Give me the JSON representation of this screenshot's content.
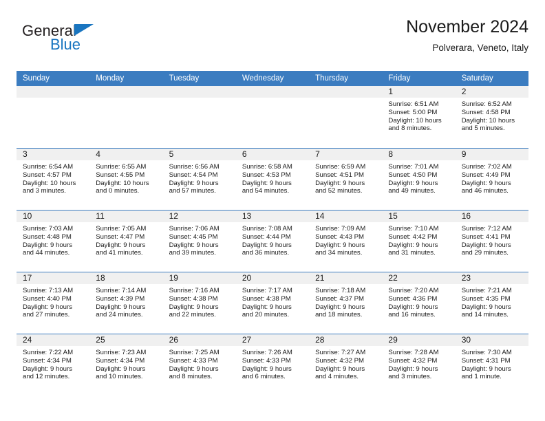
{
  "logo": {
    "word1": "General",
    "word2": "Blue",
    "triangle_color": "#1975c0",
    "icon": "triangle-icon"
  },
  "header": {
    "title": "November 2024",
    "subtitle": "Polverara, Veneto, Italy"
  },
  "theme": {
    "header_blue": "#3b7cc0",
    "daynum_gray": "#f0f0f0",
    "accent": "#1975c0"
  },
  "calendar": {
    "weekdays": [
      "Sunday",
      "Monday",
      "Tuesday",
      "Wednesday",
      "Thursday",
      "Friday",
      "Saturday"
    ],
    "weeks": [
      [
        {
          "day": "",
          "empty": true,
          "lines": []
        },
        {
          "day": "",
          "empty": true,
          "lines": []
        },
        {
          "day": "",
          "empty": true,
          "lines": []
        },
        {
          "day": "",
          "empty": true,
          "lines": []
        },
        {
          "day": "",
          "empty": true,
          "lines": []
        },
        {
          "day": "1",
          "empty": false,
          "lines": [
            "Sunrise: 6:51 AM",
            "Sunset: 5:00 PM",
            "Daylight: 10 hours",
            "and 8 minutes."
          ]
        },
        {
          "day": "2",
          "empty": false,
          "lines": [
            "Sunrise: 6:52 AM",
            "Sunset: 4:58 PM",
            "Daylight: 10 hours",
            "and 5 minutes."
          ]
        }
      ],
      [
        {
          "day": "3",
          "empty": false,
          "lines": [
            "Sunrise: 6:54 AM",
            "Sunset: 4:57 PM",
            "Daylight: 10 hours",
            "and 3 minutes."
          ]
        },
        {
          "day": "4",
          "empty": false,
          "lines": [
            "Sunrise: 6:55 AM",
            "Sunset: 4:55 PM",
            "Daylight: 10 hours",
            "and 0 minutes."
          ]
        },
        {
          "day": "5",
          "empty": false,
          "lines": [
            "Sunrise: 6:56 AM",
            "Sunset: 4:54 PM",
            "Daylight: 9 hours",
            "and 57 minutes."
          ]
        },
        {
          "day": "6",
          "empty": false,
          "lines": [
            "Sunrise: 6:58 AM",
            "Sunset: 4:53 PM",
            "Daylight: 9 hours",
            "and 54 minutes."
          ]
        },
        {
          "day": "7",
          "empty": false,
          "lines": [
            "Sunrise: 6:59 AM",
            "Sunset: 4:51 PM",
            "Daylight: 9 hours",
            "and 52 minutes."
          ]
        },
        {
          "day": "8",
          "empty": false,
          "lines": [
            "Sunrise: 7:01 AM",
            "Sunset: 4:50 PM",
            "Daylight: 9 hours",
            "and 49 minutes."
          ]
        },
        {
          "day": "9",
          "empty": false,
          "lines": [
            "Sunrise: 7:02 AM",
            "Sunset: 4:49 PM",
            "Daylight: 9 hours",
            "and 46 minutes."
          ]
        }
      ],
      [
        {
          "day": "10",
          "empty": false,
          "lines": [
            "Sunrise: 7:03 AM",
            "Sunset: 4:48 PM",
            "Daylight: 9 hours",
            "and 44 minutes."
          ]
        },
        {
          "day": "11",
          "empty": false,
          "lines": [
            "Sunrise: 7:05 AM",
            "Sunset: 4:47 PM",
            "Daylight: 9 hours",
            "and 41 minutes."
          ]
        },
        {
          "day": "12",
          "empty": false,
          "lines": [
            "Sunrise: 7:06 AM",
            "Sunset: 4:45 PM",
            "Daylight: 9 hours",
            "and 39 minutes."
          ]
        },
        {
          "day": "13",
          "empty": false,
          "lines": [
            "Sunrise: 7:08 AM",
            "Sunset: 4:44 PM",
            "Daylight: 9 hours",
            "and 36 minutes."
          ]
        },
        {
          "day": "14",
          "empty": false,
          "lines": [
            "Sunrise: 7:09 AM",
            "Sunset: 4:43 PM",
            "Daylight: 9 hours",
            "and 34 minutes."
          ]
        },
        {
          "day": "15",
          "empty": false,
          "lines": [
            "Sunrise: 7:10 AM",
            "Sunset: 4:42 PM",
            "Daylight: 9 hours",
            "and 31 minutes."
          ]
        },
        {
          "day": "16",
          "empty": false,
          "lines": [
            "Sunrise: 7:12 AM",
            "Sunset: 4:41 PM",
            "Daylight: 9 hours",
            "and 29 minutes."
          ]
        }
      ],
      [
        {
          "day": "17",
          "empty": false,
          "lines": [
            "Sunrise: 7:13 AM",
            "Sunset: 4:40 PM",
            "Daylight: 9 hours",
            "and 27 minutes."
          ]
        },
        {
          "day": "18",
          "empty": false,
          "lines": [
            "Sunrise: 7:14 AM",
            "Sunset: 4:39 PM",
            "Daylight: 9 hours",
            "and 24 minutes."
          ]
        },
        {
          "day": "19",
          "empty": false,
          "lines": [
            "Sunrise: 7:16 AM",
            "Sunset: 4:38 PM",
            "Daylight: 9 hours",
            "and 22 minutes."
          ]
        },
        {
          "day": "20",
          "empty": false,
          "lines": [
            "Sunrise: 7:17 AM",
            "Sunset: 4:38 PM",
            "Daylight: 9 hours",
            "and 20 minutes."
          ]
        },
        {
          "day": "21",
          "empty": false,
          "lines": [
            "Sunrise: 7:18 AM",
            "Sunset: 4:37 PM",
            "Daylight: 9 hours",
            "and 18 minutes."
          ]
        },
        {
          "day": "22",
          "empty": false,
          "lines": [
            "Sunrise: 7:20 AM",
            "Sunset: 4:36 PM",
            "Daylight: 9 hours",
            "and 16 minutes."
          ]
        },
        {
          "day": "23",
          "empty": false,
          "lines": [
            "Sunrise: 7:21 AM",
            "Sunset: 4:35 PM",
            "Daylight: 9 hours",
            "and 14 minutes."
          ]
        }
      ],
      [
        {
          "day": "24",
          "empty": false,
          "lines": [
            "Sunrise: 7:22 AM",
            "Sunset: 4:34 PM",
            "Daylight: 9 hours",
            "and 12 minutes."
          ]
        },
        {
          "day": "25",
          "empty": false,
          "lines": [
            "Sunrise: 7:23 AM",
            "Sunset: 4:34 PM",
            "Daylight: 9 hours",
            "and 10 minutes."
          ]
        },
        {
          "day": "26",
          "empty": false,
          "lines": [
            "Sunrise: 7:25 AM",
            "Sunset: 4:33 PM",
            "Daylight: 9 hours",
            "and 8 minutes."
          ]
        },
        {
          "day": "27",
          "empty": false,
          "lines": [
            "Sunrise: 7:26 AM",
            "Sunset: 4:33 PM",
            "Daylight: 9 hours",
            "and 6 minutes."
          ]
        },
        {
          "day": "28",
          "empty": false,
          "lines": [
            "Sunrise: 7:27 AM",
            "Sunset: 4:32 PM",
            "Daylight: 9 hours",
            "and 4 minutes."
          ]
        },
        {
          "day": "29",
          "empty": false,
          "lines": [
            "Sunrise: 7:28 AM",
            "Sunset: 4:32 PM",
            "Daylight: 9 hours",
            "and 3 minutes."
          ]
        },
        {
          "day": "30",
          "empty": false,
          "lines": [
            "Sunrise: 7:30 AM",
            "Sunset: 4:31 PM",
            "Daylight: 9 hours",
            "and 1 minute."
          ]
        }
      ]
    ]
  }
}
